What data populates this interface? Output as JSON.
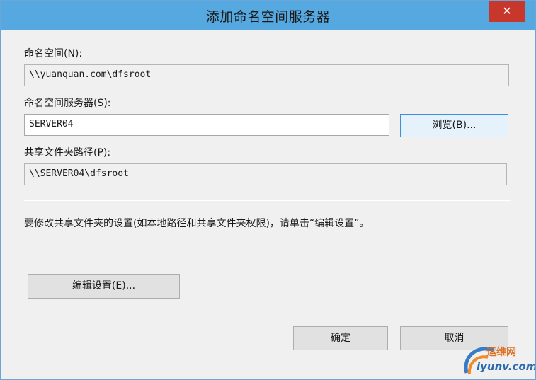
{
  "window": {
    "title": "添加命名空间服务器",
    "close_glyph": "✕"
  },
  "namespace": {
    "label": "命名空间(N):",
    "value": "\\\\yuanquan.com\\dfsroot"
  },
  "namespace_server": {
    "label": "命名空间服务器(S):",
    "value": "SERVER04",
    "browse_label": "浏览(B)..."
  },
  "shared_folder_path": {
    "label": "共享文件夹路径(P):",
    "value": "\\\\SERVER04\\dfsroot"
  },
  "info_text": "要修改共享文件夹的设置(如本地路径和共享文件夹权限)，请单击“编辑设置”。",
  "buttons": {
    "edit_settings": "编辑设置(E)...",
    "ok": "确定",
    "cancel": "取消"
  },
  "watermark": {
    "top_text": "运维网",
    "bottom_text": "iyunv.com"
  }
}
